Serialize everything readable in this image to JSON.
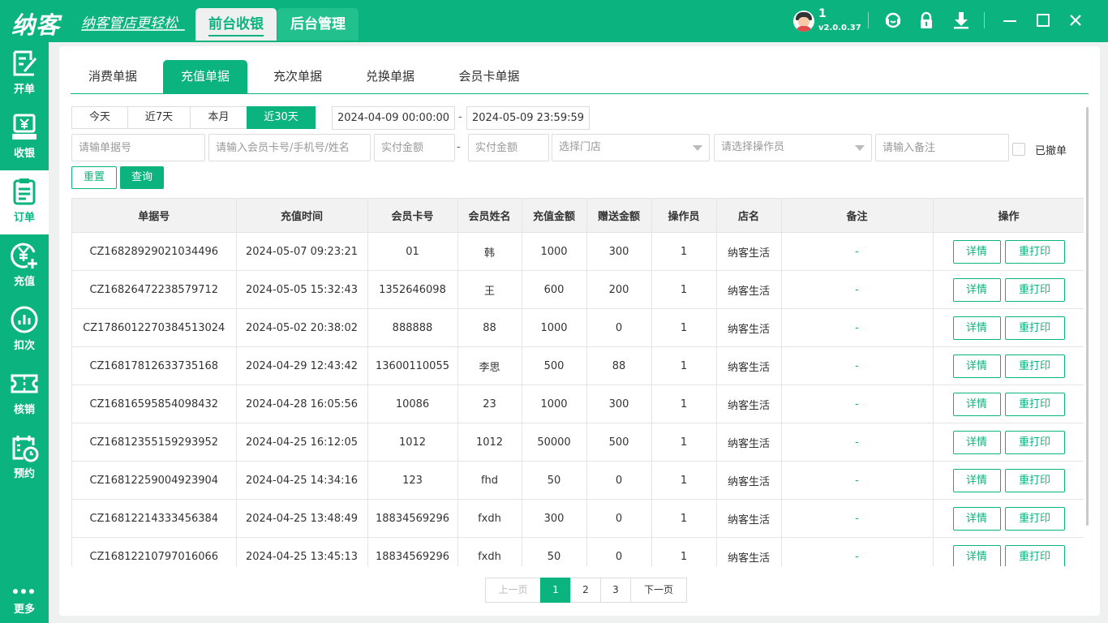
{
  "app": {
    "logo": "纳客",
    "slogan": "纳客管店更轻松",
    "top_tabs": [
      {
        "label": "前台收银",
        "active": true
      },
      {
        "label": "后台管理",
        "active": false
      }
    ],
    "user": {
      "name": "1",
      "version": "v2.0.0.37"
    },
    "window_icons": [
      "headset-icon",
      "lock-icon",
      "download-icon",
      "minimize-icon",
      "maximize-icon",
      "close-icon"
    ]
  },
  "sidebar": {
    "items": [
      {
        "label": "开单",
        "icon": "edit-icon",
        "active": false
      },
      {
        "label": "收银",
        "icon": "cashier-icon",
        "active": false
      },
      {
        "label": "订单",
        "icon": "clipboard-icon",
        "active": true
      },
      {
        "label": "充值",
        "icon": "recharge-icon",
        "active": false
      },
      {
        "label": "扣次",
        "icon": "chart-icon",
        "active": false
      },
      {
        "label": "核销",
        "icon": "ticket-icon",
        "active": false
      },
      {
        "label": "预约",
        "icon": "calendar-icon",
        "active": false
      }
    ],
    "more": "更多"
  },
  "tabs": [
    {
      "label": "消费单据",
      "active": false
    },
    {
      "label": "充值单据",
      "active": true
    },
    {
      "label": "充次单据",
      "active": false
    },
    {
      "label": "兑换单据",
      "active": false
    },
    {
      "label": "会员卡单据",
      "active": false
    }
  ],
  "filters": {
    "ranges": [
      {
        "label": "今天",
        "active": false
      },
      {
        "label": "近7天",
        "active": false
      },
      {
        "label": "本月",
        "active": false
      },
      {
        "label": "近30天",
        "active": true
      }
    ],
    "date_start": "2024-04-09 00:00:00",
    "date_end": "2024-05-09 23:59:59",
    "date_sep": "-",
    "order_no_placeholder": "请输单据号",
    "member_placeholder": "请输入会员卡号/手机号/姓名",
    "amount_min_placeholder": "实付金额",
    "amount_sep": "-",
    "amount_max_placeholder": "实付金额",
    "store_placeholder": "选择门店",
    "operator_placeholder": "请选择操作员",
    "remark_placeholder": "请输入备注",
    "cancelled_label": "已撤单",
    "reset_label": "重置",
    "query_label": "查询"
  },
  "table": {
    "columns": [
      "单据号",
      "充值时间",
      "会员卡号",
      "会员姓名",
      "充值金额",
      "赠送金额",
      "操作员",
      "店名",
      "备注",
      "操作"
    ],
    "detail_label": "详情",
    "reprint_label": "重打印",
    "rows": [
      {
        "no": "CZ16828929021034496",
        "time": "2024-05-07 09:23:21",
        "card": "01",
        "name": "韩",
        "amount": "1000",
        "bonus": "300",
        "operator": "1",
        "store": "纳客生活",
        "remark": "-"
      },
      {
        "no": "CZ16826472238579712",
        "time": "2024-05-05 15:32:43",
        "card": "1352646098",
        "name": "王",
        "amount": "600",
        "bonus": "200",
        "operator": "1",
        "store": "纳客生活",
        "remark": "-"
      },
      {
        "no": "CZ17860122703845130​24",
        "time": "2024-05-02 20:38:02",
        "card": "888888",
        "name": "88",
        "amount": "1000",
        "bonus": "0",
        "operator": "1",
        "store": "纳客生活",
        "remark": "-"
      },
      {
        "no": "CZ16817812633735168",
        "time": "2024-04-29 12:43:42",
        "card": "13600110055",
        "name": "李思",
        "amount": "500",
        "bonus": "88",
        "operator": "1",
        "store": "纳客生活",
        "remark": "-"
      },
      {
        "no": "CZ16816595854098432",
        "time": "2024-04-28 16:05:56",
        "card": "10086",
        "name": "23",
        "amount": "1000",
        "bonus": "300",
        "operator": "1",
        "store": "纳客生活",
        "remark": "-"
      },
      {
        "no": "CZ16812355159293952",
        "time": "2024-04-25 16:12:05",
        "card": "1012",
        "name": "1012",
        "amount": "50000",
        "bonus": "500",
        "operator": "1",
        "store": "纳客生活",
        "remark": "-"
      },
      {
        "no": "CZ16812259004923904",
        "time": "2024-04-25 14:34:16",
        "card": "123",
        "name": "fhd",
        "amount": "50",
        "bonus": "0",
        "operator": "1",
        "store": "纳客生活",
        "remark": "-"
      },
      {
        "no": "CZ16812214333456384",
        "time": "2024-04-25 13:48:49",
        "card": "18834569296",
        "name": "fxdh",
        "amount": "300",
        "bonus": "0",
        "operator": "1",
        "store": "纳客生活",
        "remark": "-"
      },
      {
        "no": "CZ16812210797016066",
        "time": "2024-04-25 13:45:13",
        "card": "18834569296",
        "name": "fxdh",
        "amount": "50",
        "bonus": "0",
        "operator": "1",
        "store": "纳客生活",
        "remark": "-"
      }
    ]
  },
  "pagination": {
    "prev": "上一页",
    "pages": [
      "1",
      "2",
      "3"
    ],
    "current": "1",
    "next": "下一页"
  }
}
